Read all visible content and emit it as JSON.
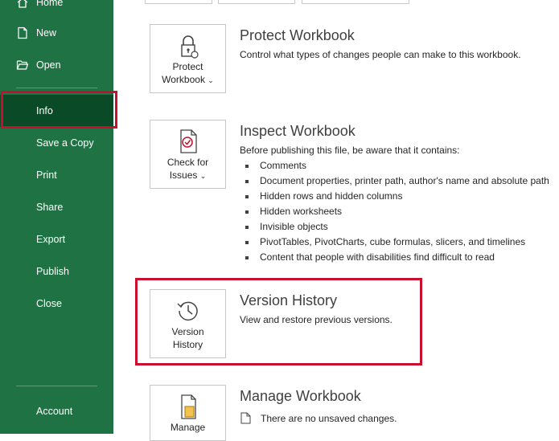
{
  "sidebar": {
    "items": [
      {
        "label": "Home",
        "icon": "home-icon"
      },
      {
        "label": "New",
        "icon": "new-file-icon"
      },
      {
        "label": "Open",
        "icon": "folder-open-icon"
      },
      {
        "label": "Info"
      },
      {
        "label": "Save a Copy"
      },
      {
        "label": "Print"
      },
      {
        "label": "Share"
      },
      {
        "label": "Export"
      },
      {
        "label": "Publish"
      },
      {
        "label": "Close"
      },
      {
        "label": "Account"
      }
    ],
    "active": "Info"
  },
  "protect": {
    "button_line1": "Protect",
    "button_line2": "Workbook",
    "title": "Protect Workbook",
    "desc": "Control what types of changes people can make to this workbook."
  },
  "inspect": {
    "button_line1": "Check for",
    "button_line2": "Issues",
    "title": "Inspect Workbook",
    "desc": "Before publishing this file, be aware that it contains:",
    "items": [
      "Comments",
      "Document properties, printer path, author's name and absolute path",
      "Hidden rows and hidden columns",
      "Hidden worksheets",
      "Invisible objects",
      "PivotTables, PivotCharts, cube formulas, slicers, and timelines",
      "Content that people with disabilities find difficult to read"
    ]
  },
  "version": {
    "button_line1": "Version",
    "button_line2": "History",
    "title": "Version History",
    "desc": "View and restore previous versions."
  },
  "manage": {
    "button_line1": "Manage",
    "title": "Manage Workbook",
    "desc": "There are no unsaved changes."
  },
  "colors": {
    "sidebar_bg": "#1f7244",
    "active_bg": "#0b4a26",
    "highlight": "#c8102e"
  }
}
